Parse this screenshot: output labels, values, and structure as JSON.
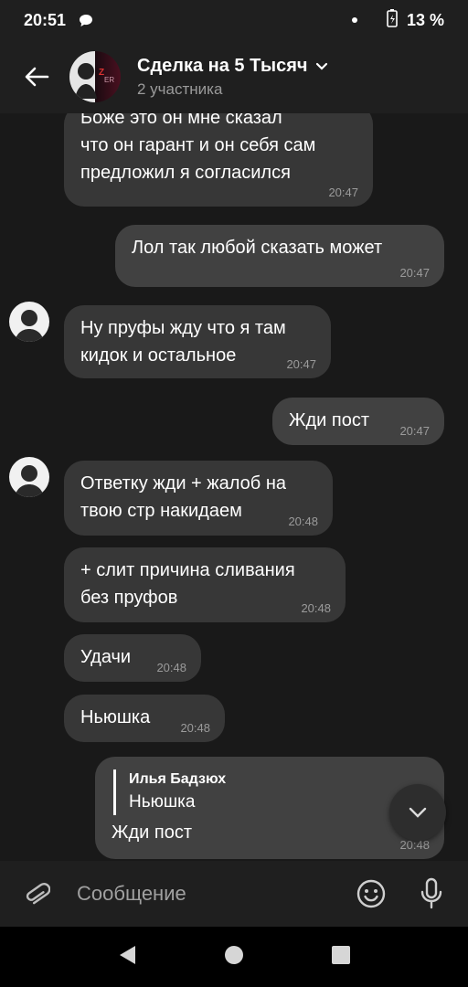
{
  "status_bar": {
    "time": "20:51",
    "battery": "13 %"
  },
  "header": {
    "title": "Сделка на 5 Тысяч",
    "subtitle": "2 участника"
  },
  "messages": [
    {
      "id": "m1",
      "direction": "in",
      "lines": [
        "Боже это он мне сказал",
        "что он гарант и он себя сам",
        "предложил я согласился"
      ],
      "time": "20:47"
    },
    {
      "id": "m2",
      "direction": "out",
      "lines": [
        "Лол так любой сказать может"
      ],
      "time": "20:47"
    },
    {
      "id": "m3",
      "direction": "in",
      "lines": [
        "Ну пруфы жду что я там",
        "кидок и остальное"
      ],
      "time": "20:47"
    },
    {
      "id": "m4",
      "direction": "out",
      "lines": [
        "Жди пост"
      ],
      "time": "20:47"
    },
    {
      "id": "m5",
      "direction": "in",
      "lines": [
        "Ответку жди + жалоб на",
        "твою стр накидаем"
      ],
      "time": "20:48"
    },
    {
      "id": "m6",
      "direction": "in",
      "lines": [
        "+ слит причина сливания",
        "без пруфов"
      ],
      "time": "20:48"
    },
    {
      "id": "m7",
      "direction": "in",
      "lines": [
        "Удачи"
      ],
      "time": "20:48"
    },
    {
      "id": "m8",
      "direction": "in",
      "lines": [
        "Ньюшка"
      ],
      "time": "20:48"
    },
    {
      "id": "m9",
      "direction": "out",
      "reply": {
        "author": "Илья Бадзюх",
        "text": "Ньюшка"
      },
      "lines": [
        "Жди пост"
      ],
      "time": "20:48"
    }
  ],
  "composer": {
    "placeholder": "Сообщение"
  },
  "icons": {
    "back": "arrow-left-icon",
    "chevron": "chevron-down-icon",
    "attach": "paperclip-icon",
    "emoji": "smiley-icon",
    "mic": "microphone-icon",
    "scroll_down": "chevron-down-icon"
  },
  "colors": {
    "background": "#191919",
    "bubble_in": "#373737",
    "bubble_out": "#414141",
    "bar": "#1f1f1f"
  }
}
